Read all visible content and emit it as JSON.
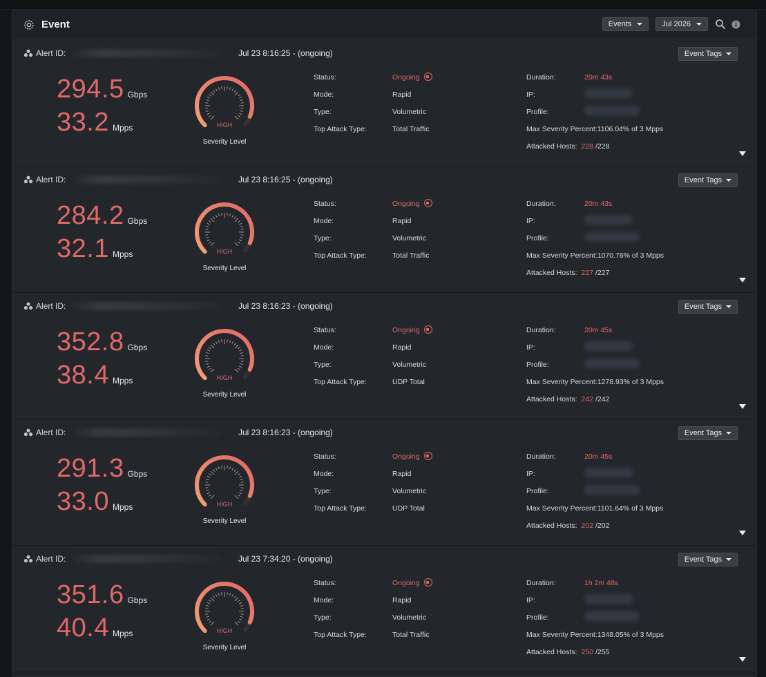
{
  "panel": {
    "title": "Event",
    "icon": "event-gear-icon",
    "controls": {
      "filter_label": "Events",
      "date_label": "Jul 2026",
      "search_icon": "search-icon",
      "info_icon": "info-icon"
    }
  },
  "labels": {
    "alert_id": "Alert ID:",
    "tags_button": "Event Tags",
    "severity": "Severity Level",
    "status": "Status:",
    "mode": "Mode:",
    "type": "Type:",
    "top_attack": "Top Attack Type:",
    "duration": "Duration:",
    "ip": "IP:",
    "profile": "Profile:",
    "attacked_hosts": "Attacked Hosts:",
    "gbps": "Gbps",
    "mpps": "Mpps"
  },
  "colors": {
    "accent_red": "#e06868",
    "gauge_start": "#f2a070",
    "gauge_end": "#e06868"
  },
  "events": [
    {
      "time": "Jul 23 8:16:25 - (ongoing)",
      "gbps": "294.5",
      "mpps": "33.2",
      "severity": "HIGH",
      "severity_level": 0.92,
      "status": "Ongoing",
      "mode": "Rapid",
      "type": "Volumetric",
      "top_attack": "Total Traffic",
      "duration": "20m 43s",
      "max_severity": "Max Severity Percent:1106.04% of 3 Mpps",
      "hosts_attacked": "228",
      "hosts_total": "/228"
    },
    {
      "time": "Jul 23 8:16:25 - (ongoing)",
      "gbps": "284.2",
      "mpps": "32.1",
      "severity": "HIGH",
      "severity_level": 0.92,
      "status": "Ongoing",
      "mode": "Rapid",
      "type": "Volumetric",
      "top_attack": "Total Traffic",
      "duration": "20m 43s",
      "max_severity": "Max Severity Percent:1070.76% of 3 Mpps",
      "hosts_attacked": "227",
      "hosts_total": "/227"
    },
    {
      "time": "Jul 23 8:16:23 - (ongoing)",
      "gbps": "352.8",
      "mpps": "38.4",
      "severity": "HIGH",
      "severity_level": 0.92,
      "status": "Ongoing",
      "mode": "Rapid",
      "type": "Volumetric",
      "top_attack": "UDP Total",
      "duration": "20m 45s",
      "max_severity": "Max Severity Percent:1278.93% of 3 Mpps",
      "hosts_attacked": "242",
      "hosts_total": "/242"
    },
    {
      "time": "Jul 23 8:16:23 - (ongoing)",
      "gbps": "291.3",
      "mpps": "33.0",
      "severity": "HIGH",
      "severity_level": 0.92,
      "status": "Ongoing",
      "mode": "Rapid",
      "type": "Volumetric",
      "top_attack": "UDP Total",
      "duration": "20m 45s",
      "max_severity": "Max Severity Percent:1101.64% of 3 Mpps",
      "hosts_attacked": "202",
      "hosts_total": "/202"
    },
    {
      "time": "Jul 23 7:34:20 - (ongoing)",
      "gbps": "351.6",
      "mpps": "40.4",
      "severity": "HIGH",
      "severity_level": 0.92,
      "status": "Ongoing",
      "mode": "Rapid",
      "type": "Volumetric",
      "top_attack": "Total Traffic",
      "duration": "1h 2m 48s",
      "max_severity": "Max Severity Percent:1348.05% of 3 Mpps",
      "hosts_attacked": "250",
      "hosts_total": "/255"
    }
  ]
}
